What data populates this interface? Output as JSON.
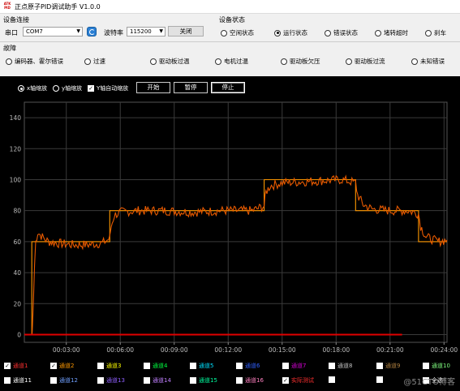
{
  "window": {
    "title": "正点原子PID调试助手 V1.0.0",
    "logo_text": "ATK PID"
  },
  "connection": {
    "group_title": "设备连接",
    "port_label": "串口",
    "port_value": "COM7",
    "baud_label": "波特率",
    "baud_value": "115200",
    "close_button": "关闭"
  },
  "device_status": {
    "group_title": "设备状态",
    "options": [
      {
        "label": "空闲状态",
        "selected": false
      },
      {
        "label": "运行状态",
        "selected": true
      },
      {
        "label": "错误状态",
        "selected": false
      },
      {
        "label": "堵转超时",
        "selected": false
      },
      {
        "label": "刹车",
        "selected": false
      }
    ]
  },
  "faults": {
    "group_title": "故障",
    "options": [
      {
        "label": "编码器、霍尔错误"
      },
      {
        "label": "过速"
      },
      {
        "label": "驱动板过温"
      },
      {
        "label": "电机过温"
      },
      {
        "label": "驱动板欠压"
      },
      {
        "label": "驱动板过流"
      },
      {
        "label": "未知错误"
      }
    ]
  },
  "plot_controls": {
    "x_zoom": "x轴缩放",
    "y_zoom": "y轴缩放",
    "y_auto": "Y轴自动缩放",
    "start": "开始",
    "pause": "暂停",
    "stop": "停止"
  },
  "chart_data": {
    "type": "line",
    "xlabel": "",
    "ylabel": "",
    "ylim": [
      -5,
      150
    ],
    "yticks": [
      0,
      20,
      40,
      60,
      80,
      100,
      120,
      140
    ],
    "xticks": [
      "00:03:00",
      "00:06:00",
      "00:09:00",
      "00:12:00",
      "00:15:00",
      "00:18:00",
      "00:21:00",
      "00:24:00"
    ],
    "xlim_seconds": [
      40,
      1450
    ],
    "grid": true,
    "series": [
      {
        "color": "#ff9900",
        "style": "step",
        "x_seconds": [
          40,
          65,
          65,
          325,
          325,
          840,
          840,
          1145,
          1145,
          1355,
          1355,
          1450
        ],
        "values": [
          0,
          0,
          60,
          60,
          80,
          80,
          100,
          100,
          80,
          80,
          60,
          60
        ]
      },
      {
        "color": "#e85a00",
        "style": "noisy",
        "x_seconds": [
          40,
          66,
          70,
          74,
          78,
          85,
          100,
          120,
          150,
          200,
          250,
          300,
          325,
          330,
          340,
          360,
          420,
          500,
          600,
          700,
          800,
          840,
          846,
          860,
          900,
          1000,
          1100,
          1145,
          1152,
          1170,
          1200,
          1260,
          1320,
          1355,
          1362,
          1380,
          1420,
          1450
        ],
        "values": [
          0,
          0,
          20,
          45,
          60,
          66,
          63,
          60,
          59,
          58,
          58,
          59,
          62,
          70,
          77,
          79,
          80,
          80,
          79,
          80,
          80,
          83,
          92,
          96,
          98,
          99,
          100,
          98,
          90,
          84,
          81,
          80,
          80,
          78,
          70,
          63,
          60,
          61
        ]
      },
      {
        "color": "#e00000",
        "style": "line",
        "x_seconds": [
          40,
          1300
        ],
        "values": [
          0,
          0
        ]
      }
    ]
  },
  "channels": {
    "row1": [
      {
        "label": "通道1",
        "checked": true,
        "color": "#ff3030"
      },
      {
        "label": "通道2",
        "checked": true,
        "color": "#ff9900"
      },
      {
        "label": "通道3",
        "checked": false,
        "color": "#ffff00"
      },
      {
        "label": "通道4",
        "checked": false,
        "color": "#00ff40"
      },
      {
        "label": "通道5",
        "checked": false,
        "color": "#00e0ff"
      },
      {
        "label": "通道6",
        "checked": false,
        "color": "#3060ff"
      },
      {
        "label": "通道7",
        "checked": false,
        "color": "#d000d0"
      },
      {
        "label": "通道8",
        "checked": false,
        "color": "#c0c0c0"
      },
      {
        "label": "通道9",
        "checked": false,
        "color": "#b08040"
      },
      {
        "label": "通道10",
        "checked": false,
        "color": "#80ff80"
      }
    ],
    "row2": [
      {
        "label": "通道11",
        "checked": false,
        "color": "#ffffff"
      },
      {
        "label": "通道12",
        "checked": false,
        "color": "#70a0ff"
      },
      {
        "label": "通道13",
        "checked": false,
        "color": "#9060ff"
      },
      {
        "label": "通道14",
        "checked": false,
        "color": "#c080ff"
      },
      {
        "label": "通道15",
        "checked": false,
        "color": "#00ffa0"
      },
      {
        "label": "通道16",
        "checked": false,
        "color": "#ff80c0"
      },
      {
        "label": "实际测试",
        "checked": true,
        "color": "#ff3030"
      },
      {
        "label": "",
        "checked": false,
        "color": "#ffffff"
      },
      {
        "label": "",
        "checked": false,
        "color": "#ffffff"
      },
      {
        "label": "全选",
        "checked": false,
        "color": "#ffffff"
      }
    ]
  },
  "watermark": "@51CTO博客"
}
